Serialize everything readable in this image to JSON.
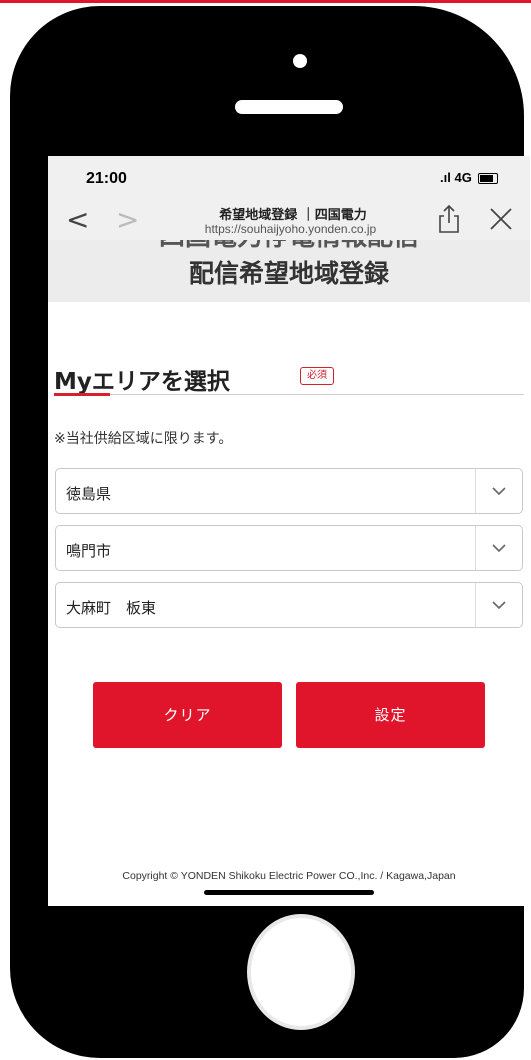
{
  "status_bar": {
    "time": "21:00",
    "network": "4G"
  },
  "browser": {
    "back_icon": "back-chevron-icon",
    "forward_icon": "forward-chevron-icon",
    "page_title": "希望地域登録 ｜四国電力",
    "url": "https://souhaijyoho.yonden.co.jp",
    "share_icon": "share-icon",
    "close_icon": "close-icon"
  },
  "page": {
    "heading_partial": "四国電力停電情報配信",
    "heading": "配信希望地域登録",
    "section_title": "Myエリアを選択",
    "required_badge": "必須",
    "note": "※当社供給区域に限ります。"
  },
  "selects": {
    "prefecture": "徳島県",
    "city": "鳴門市",
    "area": "大麻町　板東"
  },
  "buttons": {
    "clear": "クリア",
    "set": "設定"
  },
  "footer": {
    "copyright": "Copyright © YONDEN Shikoku Electric Power CO.,Inc. / Kagawa,Japan"
  },
  "colors": {
    "accent": "#e0142a",
    "band": "#ececec"
  }
}
